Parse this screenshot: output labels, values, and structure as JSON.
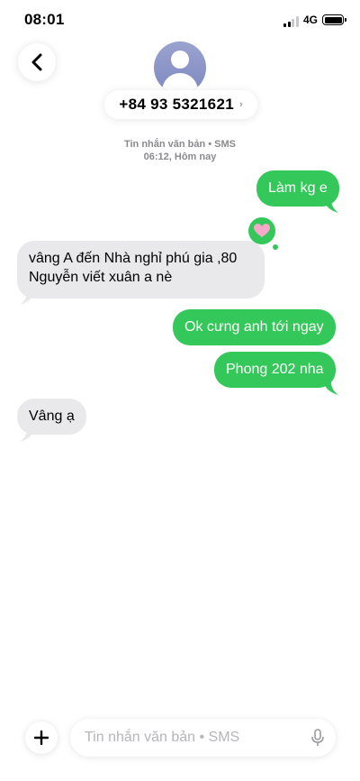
{
  "status_bar": {
    "time": "08:01",
    "network": "4G"
  },
  "header": {
    "contact": "+84 93 5321621",
    "chevron": "›"
  },
  "meta": {
    "line1": "Tin nhắn văn bản • SMS",
    "line2": "06:12, Hôm nay"
  },
  "messages": [
    {
      "direction": "outgoing",
      "text": "Làm kg e"
    },
    {
      "direction": "incoming",
      "line1": "vâng A đến Nhà nghỉ phú gia ,80",
      "line2": "Nguyễn viết xuân a nè",
      "reaction": "heart-icon"
    },
    {
      "direction": "outgoing",
      "text": "Ok cưng anh tới ngay"
    },
    {
      "direction": "outgoing",
      "text": "Phong 202 nha"
    },
    {
      "direction": "incoming",
      "text": "Vâng ạ"
    }
  ],
  "composer": {
    "placeholder": "Tin nhắn văn bản • SMS"
  },
  "colors": {
    "outgoing_bubble": "#34c759",
    "incoming_bubble": "#e9e9eb",
    "reaction_heart": "#f7a8c8"
  }
}
